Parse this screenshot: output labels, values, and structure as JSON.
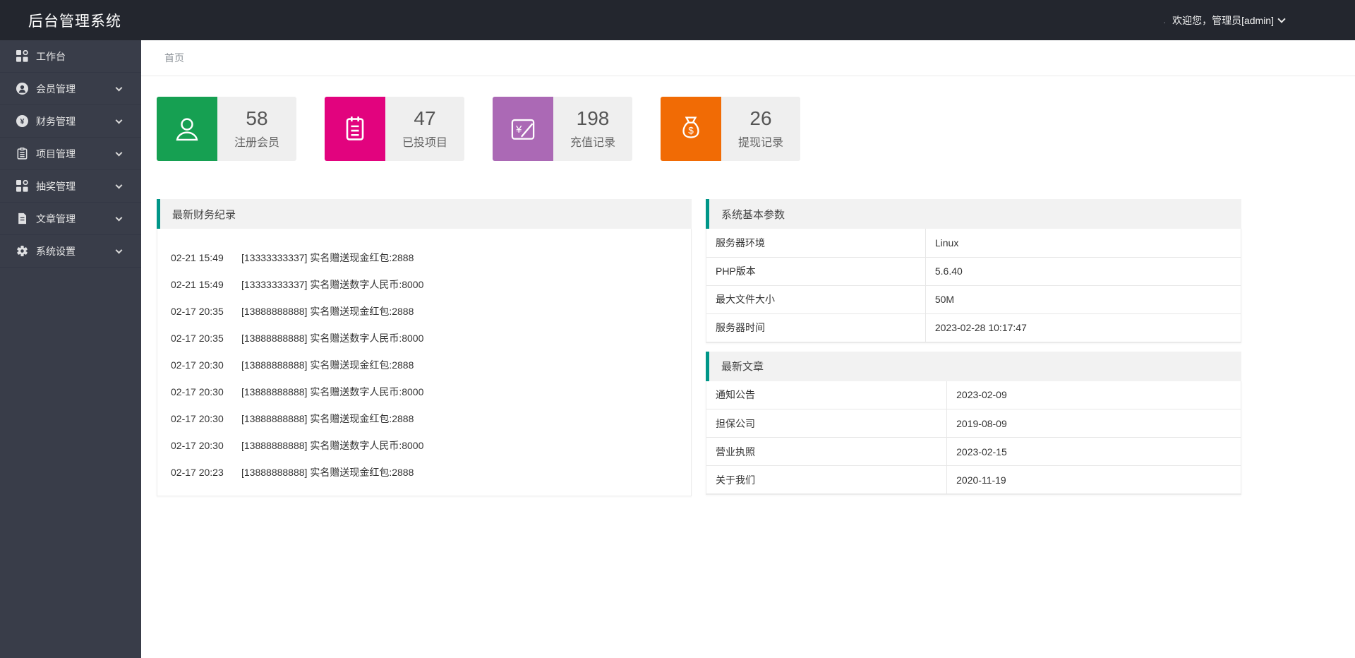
{
  "colors": {
    "accent": "#009688",
    "header_bg": "#23262e",
    "sidebar_bg": "#393d49"
  },
  "header": {
    "title": "后台管理系统",
    "welcome_prefix": ".",
    "welcome": "欢迎您，管理员[admin]"
  },
  "sidebar": {
    "items": [
      {
        "label": "工作台",
        "icon": "console-icon",
        "has_submenu": false
      },
      {
        "label": "会员管理",
        "icon": "member-circle-icon",
        "has_submenu": true
      },
      {
        "label": "财务管理",
        "icon": "rmb-circle-icon",
        "has_submenu": true
      },
      {
        "label": "项目管理",
        "icon": "clipboard-icon",
        "has_submenu": true
      },
      {
        "label": "抽奖管理",
        "icon": "grid-icon",
        "has_submenu": true
      },
      {
        "label": "文章管理",
        "icon": "document-icon",
        "has_submenu": true
      },
      {
        "label": "系统设置",
        "icon": "gear-icon",
        "has_submenu": true
      }
    ]
  },
  "breadcrumb": "首页",
  "stats": [
    {
      "value": "58",
      "label": "注册会员",
      "color": "#16a052",
      "icon": "user-icon"
    },
    {
      "value": "47",
      "label": "已投项目",
      "color": "#e2037e",
      "icon": "memo-icon"
    },
    {
      "value": "198",
      "label": "充值记录",
      "color": "#ab69b5",
      "icon": "recharge-icon"
    },
    {
      "value": "26",
      "label": "提现记录",
      "color": "#f16b05",
      "icon": "moneybag-icon"
    }
  ],
  "finance_panel": {
    "title": "最新财务纪录",
    "records": [
      {
        "time": "02-21 15:49",
        "text": "[13333333337] 实名赠送现金红包:2888"
      },
      {
        "time": "02-21 15:49",
        "text": "[13333333337] 实名赠送数字人民币:8000"
      },
      {
        "time": "02-17 20:35",
        "text": "[13888888888] 实名赠送现金红包:2888"
      },
      {
        "time": "02-17 20:35",
        "text": "[13888888888] 实名赠送数字人民币:8000"
      },
      {
        "time": "02-17 20:30",
        "text": "[13888888888] 实名赠送现金红包:2888"
      },
      {
        "time": "02-17 20:30",
        "text": "[13888888888] 实名赠送数字人民币:8000"
      },
      {
        "time": "02-17 20:30",
        "text": "[13888888888] 实名赠送现金红包:2888"
      },
      {
        "time": "02-17 20:30",
        "text": "[13888888888] 实名赠送数字人民币:8000"
      },
      {
        "time": "02-17 20:23",
        "text": "[13888888888] 实名赠送现金红包:2888"
      }
    ]
  },
  "system_panel": {
    "title": "系统基本参数",
    "rows": [
      {
        "label": "服务器环境",
        "value": "Linux"
      },
      {
        "label": "PHP版本",
        "value": "5.6.40"
      },
      {
        "label": "最大文件大小",
        "value": "50M"
      },
      {
        "label": "服务器时间",
        "value": "2023-02-28 10:17:47"
      }
    ]
  },
  "articles_panel": {
    "title": "最新文章",
    "rows": [
      {
        "label": "通知公告",
        "value": "2023-02-09"
      },
      {
        "label": "担保公司",
        "value": "2019-08-09"
      },
      {
        "label": "营业执照",
        "value": "2023-02-15"
      },
      {
        "label": "关于我们",
        "value": "2020-11-19"
      }
    ]
  }
}
